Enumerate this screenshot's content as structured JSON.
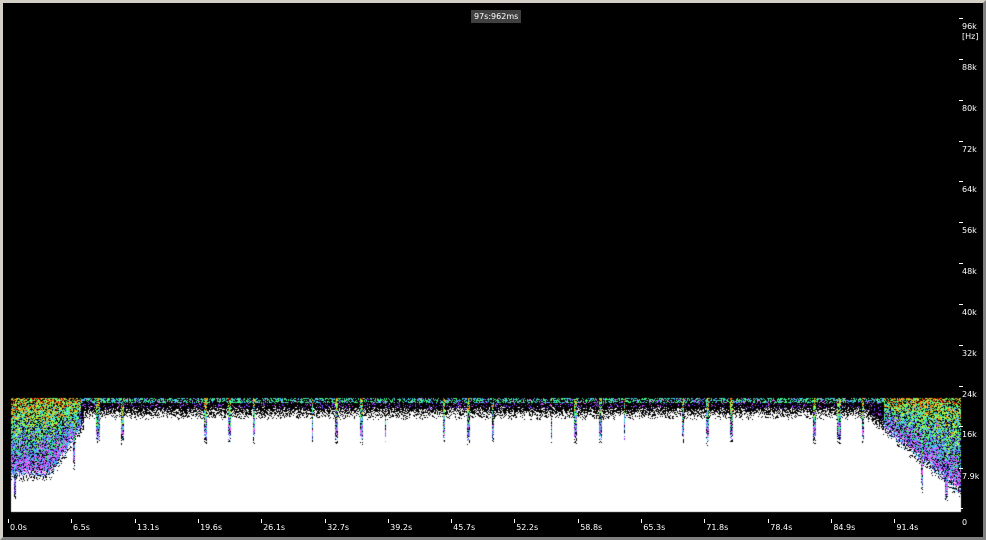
{
  "header": {
    "duration_badge": "97s:962ms"
  },
  "chart_data": {
    "type": "heatmap",
    "title": "",
    "xlabel": "",
    "ylabel": "[Hz]",
    "x_ticks": [
      "0.0s",
      "6.5s",
      "13.1s",
      "19.6s",
      "26.1s",
      "32.7s",
      "39.2s",
      "45.7s",
      "52.2s",
      "58.8s",
      "65.3s",
      "71.8s",
      "78.4s",
      "84.9s",
      "91.4s"
    ],
    "x_tick_values": [
      0.0,
      6.5,
      13.1,
      19.6,
      26.1,
      32.7,
      39.2,
      45.7,
      52.2,
      58.8,
      65.3,
      71.8,
      78.4,
      84.9,
      91.4
    ],
    "xlim": [
      0,
      97.962
    ],
    "y_ticks": [
      "96k",
      "88k",
      "80k",
      "72k",
      "64k",
      "56k",
      "48k",
      "40k",
      "32k",
      "24k",
      "16k",
      "7.9k",
      "0"
    ],
    "y_tick_values": [
      96000,
      88000,
      80000,
      72000,
      64000,
      56000,
      48000,
      40000,
      32000,
      24000,
      16000,
      7900,
      0
    ],
    "ylim": [
      0,
      96000
    ],
    "content_upper_freq_hz": 22000,
    "intensity_colors": [
      "#ffffff",
      "#ff60ff",
      "#8040ff",
      "#40c0ff",
      "#40ff80",
      "#c0ff40",
      "#ff8000",
      "#c00000",
      "#400000",
      "#000000"
    ],
    "background_color": "#000000"
  }
}
